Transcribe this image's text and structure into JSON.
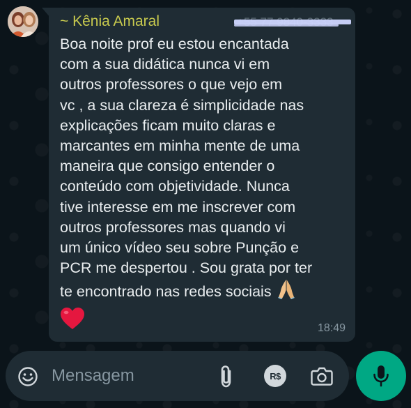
{
  "chat": {
    "sender_name": "~ Kênia Amaral",
    "message_lines": [
      "Boa noite prof eu estou encantada",
      "com a sua didática nunca vi em",
      "outros professores o que vejo em",
      "vc , a sua clareza é simplicidade nas",
      "explicações ficam muito claras e",
      "marcantes em minha mente de uma",
      "maneira que consigo entender o",
      "conteúdo com objetividade. Nunca",
      "tive interesse em me inscrever com",
      "outros professores mas quando vi",
      "um único vídeo seu sobre Punção e",
      "PCR me despertou . Sou grata por ter",
      "te encontrado nas redes sociais"
    ],
    "emoji_pray": "folded-hands-icon",
    "emoji_heart": "red-heart-icon",
    "timestamp": "18:49"
  },
  "composer": {
    "placeholder": "Mensagem",
    "pay_label": "R$"
  },
  "colors": {
    "background": "#0b141a",
    "bubble": "#1f2c34",
    "sender_name": "#c7c94e",
    "text": "#e9edef",
    "muted": "#8696a0",
    "accent": "#00a884",
    "heart": "#e5173f"
  }
}
